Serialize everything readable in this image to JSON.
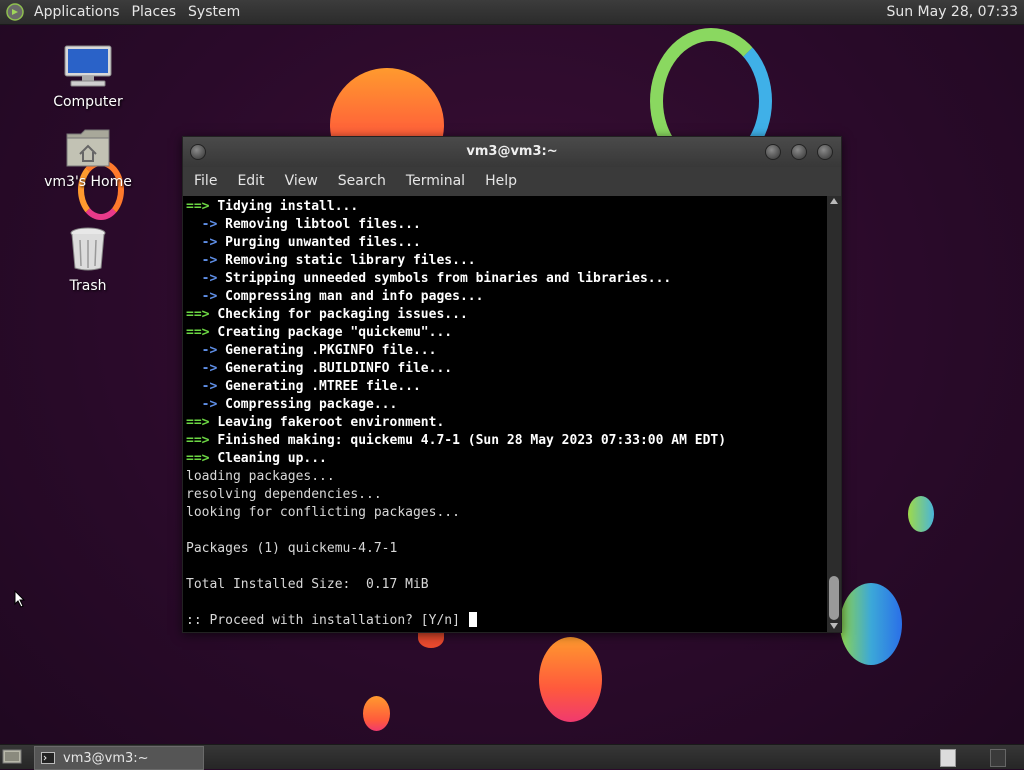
{
  "top_panel": {
    "menus": [
      "Applications",
      "Places",
      "System"
    ],
    "clock": "Sun May 28, 07:33"
  },
  "desktop": {
    "icons": [
      {
        "label": "Computer",
        "icon": "computer-icon"
      },
      {
        "label": "vm3's Home",
        "icon": "home-folder-icon"
      },
      {
        "label": "Trash",
        "icon": "trash-icon"
      }
    ]
  },
  "terminal": {
    "title": "vm3@vm3:~",
    "menus": [
      "File",
      "Edit",
      "View",
      "Search",
      "Terminal",
      "Help"
    ],
    "lines": [
      {
        "prefix": "==> ",
        "prefix_style": "green",
        "text": "Tidying install...",
        "style": "bold"
      },
      {
        "prefix": "  -> ",
        "prefix_style": "blue",
        "text": "Removing libtool files...",
        "style": "bold"
      },
      {
        "prefix": "  -> ",
        "prefix_style": "blue",
        "text": "Purging unwanted files...",
        "style": "bold"
      },
      {
        "prefix": "  -> ",
        "prefix_style": "blue",
        "text": "Removing static library files...",
        "style": "bold"
      },
      {
        "prefix": "  -> ",
        "prefix_style": "blue",
        "text": "Stripping unneeded symbols from binaries and libraries...",
        "style": "bold"
      },
      {
        "prefix": "  -> ",
        "prefix_style": "blue",
        "text": "Compressing man and info pages...",
        "style": "bold"
      },
      {
        "prefix": "==> ",
        "prefix_style": "green",
        "text": "Checking for packaging issues...",
        "style": "bold"
      },
      {
        "prefix": "==> ",
        "prefix_style": "green",
        "text": "Creating package \"quickemu\"...",
        "style": "bold"
      },
      {
        "prefix": "  -> ",
        "prefix_style": "blue",
        "text": "Generating .PKGINFO file...",
        "style": "bold"
      },
      {
        "prefix": "  -> ",
        "prefix_style": "blue",
        "text": "Generating .BUILDINFO file...",
        "style": "bold"
      },
      {
        "prefix": "  -> ",
        "prefix_style": "blue",
        "text": "Generating .MTREE file...",
        "style": "bold"
      },
      {
        "prefix": "  -> ",
        "prefix_style": "blue",
        "text": "Compressing package...",
        "style": "bold"
      },
      {
        "prefix": "==> ",
        "prefix_style": "green",
        "text": "Leaving fakeroot environment.",
        "style": "bold"
      },
      {
        "prefix": "==> ",
        "prefix_style": "green",
        "text": "Finished making: quickemu 4.7-1 (Sun 28 May 2023 07:33:00 AM EDT)",
        "style": "bold"
      },
      {
        "prefix": "==> ",
        "prefix_style": "green",
        "text": "Cleaning up...",
        "style": "bold"
      },
      {
        "prefix": "",
        "prefix_style": "none",
        "text": "loading packages...",
        "style": "plain"
      },
      {
        "prefix": "",
        "prefix_style": "none",
        "text": "resolving dependencies...",
        "style": "plain"
      },
      {
        "prefix": "",
        "prefix_style": "none",
        "text": "looking for conflicting packages...",
        "style": "plain"
      },
      {
        "prefix": "",
        "prefix_style": "none",
        "text": "",
        "style": "plain"
      },
      {
        "prefix": "",
        "prefix_style": "none",
        "text": "Packages (1) quickemu-4.7-1",
        "style": "plain"
      },
      {
        "prefix": "",
        "prefix_style": "none",
        "text": "",
        "style": "plain"
      },
      {
        "prefix": "",
        "prefix_style": "none",
        "text": "Total Installed Size:  0.17 MiB",
        "style": "plain"
      },
      {
        "prefix": "",
        "prefix_style": "none",
        "text": "",
        "style": "plain"
      },
      {
        "prefix": "",
        "prefix_style": "none",
        "text": ":: Proceed with installation? [Y/n] ",
        "style": "plain",
        "cursor": true
      }
    ]
  },
  "taskbar": {
    "window_button": "vm3@vm3:~"
  },
  "colors": {
    "prompt_green": "#6dd844",
    "arrow_blue": "#5f8fe8",
    "terminal_bg": "#000000"
  }
}
